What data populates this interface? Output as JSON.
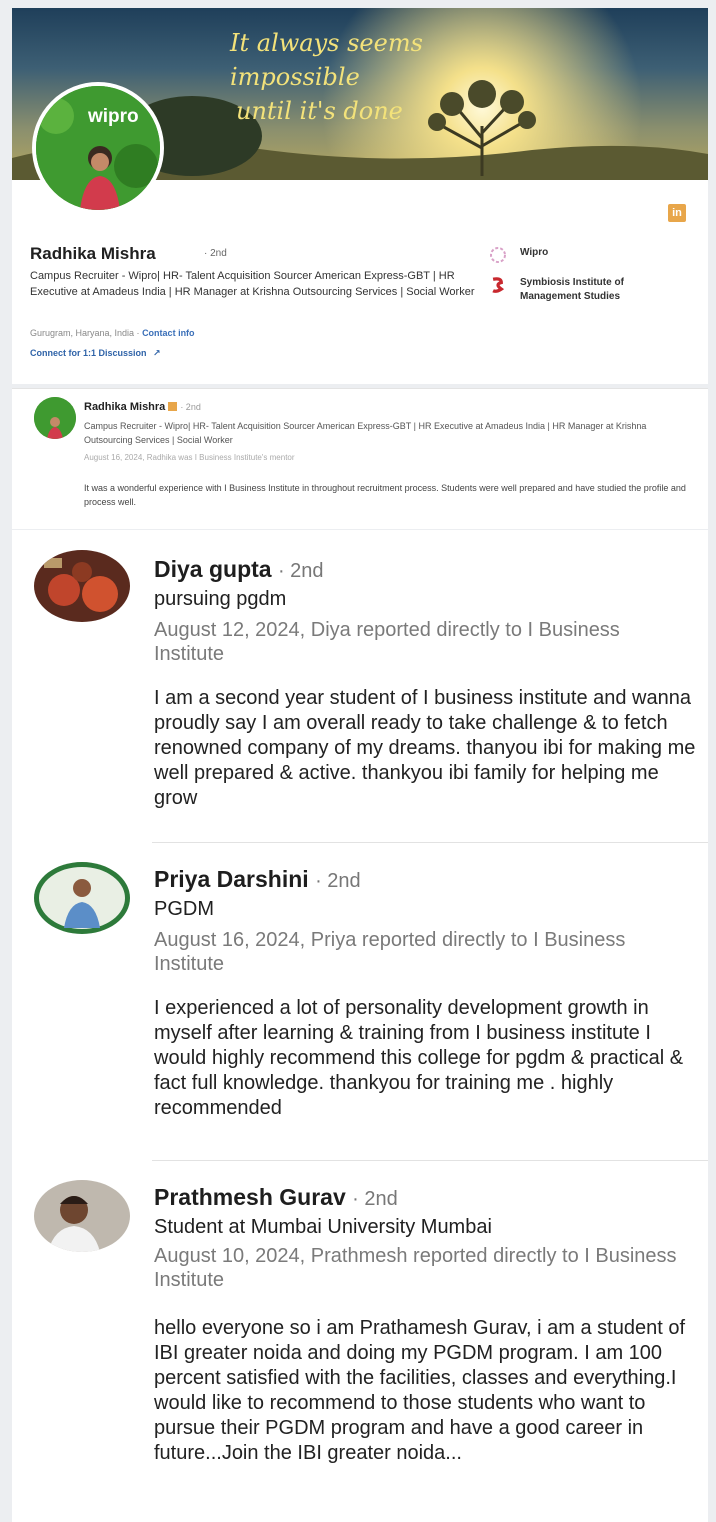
{
  "profile": {
    "banner_quote": [
      "It always seems impossible",
      "until it's done"
    ],
    "avatar_brand": "wipro",
    "linkedin_icon": "in",
    "name": "Radhika Mishra",
    "degree": "· 2nd",
    "headline": "Campus Recruiter - Wipro| HR- Talent Acquisition Sourcer American Express-GBT | HR Executive at Amadeus India | HR Manager at Krishna Outsourcing Services | Social Worker",
    "location": "Gurugram, Haryana, India ·",
    "contact_info": "Contact info",
    "connect_link": "Connect for 1:1 Discussion",
    "experience": [
      {
        "label": "Wipro",
        "logo_icon": "wipro-logo-icon"
      },
      {
        "label": "Symbiosis Institute of Management Studies",
        "logo_icon": "symbiosis-logo-icon"
      }
    ]
  },
  "recommendation_snippet": {
    "name": "Radhika Mishra",
    "degree": "· 2nd",
    "headline": "Campus Recruiter - Wipro| HR- Talent Acquisition Sourcer American Express-GBT | HR Executive at Amadeus India | HR Manager at Krishna Outsourcing Services | Social Worker",
    "date": "August 16, 2024, Radhika was I Business Institute's mentor",
    "text": "It was a wonderful experience with I Business Institute in throughout recruitment process. Students were well prepared and have studied the profile and process well."
  },
  "recommendations": [
    {
      "name": "Diya gupta",
      "degree": "· 2nd",
      "headline": "pursuing pgdm",
      "date": "August 12, 2024, Diya reported directly to I Business Institute",
      "text": "I am a second year student of I business institute and wanna proudly say I am overall ready to take challenge & to fetch renowned company of my dreams. thanyou ibi for making me well prepared & active. thankyou ibi family for helping me grow"
    },
    {
      "name": "Priya Darshini",
      "degree": "· 2nd",
      "headline": "PGDM",
      "date": "August 16, 2024, Priya reported directly to I Business Institute",
      "text": "I experienced a lot of personality development growth in myself after learning & training from I business institute I would highly recommend this college for pgdm & practical & fact full knowledge. thankyou for training me . highly recommended"
    },
    {
      "name": "Prathmesh Gurav",
      "degree": "· 2nd",
      "headline": "Student at Mumbai University Mumbai",
      "date": "August 10, 2024, Prathmesh reported directly to I Business Institute",
      "text": "hello everyone so i am Prathamesh Gurav, i am a student of IBI greater noida and doing my PGDM program. I am 100 percent satisfied with the facilities, classes and everything.I would like to recommend to those students who want to pursue their PGDM program and have a good career in future...Join the IBI greater noida..."
    }
  ],
  "colors": {
    "link": "#2f63a8",
    "linkedin_badge": "#e8a64a",
    "banner_text": "#f3e27a"
  }
}
